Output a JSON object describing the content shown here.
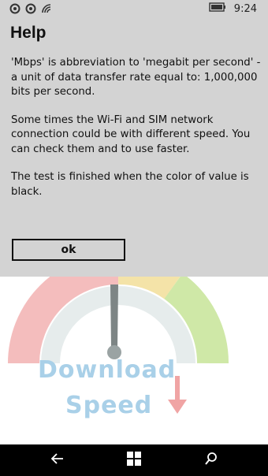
{
  "status_bar": {
    "time": "9:24"
  },
  "dialog": {
    "title": "Help",
    "paragraphs": [
      "'Mbps' is abbreviation to 'megabit per second' - a unit of data transfer rate equal to: 1,000,000 bits per second.",
      "Some times the Wi-Fi and SIM network connection could be with different speed. You can check them and to use faster.",
      "The test is finished when the color of value is black."
    ],
    "ok_label": "ok"
  },
  "background": {
    "line1": "Download",
    "line2": "Speed"
  },
  "icons": {
    "status_left": [
      "notification-icon",
      "notification-icon",
      "wifi-icon"
    ],
    "status_right": [
      "battery-icon"
    ],
    "nav": [
      "back-icon",
      "windows-start-icon",
      "search-icon"
    ]
  }
}
